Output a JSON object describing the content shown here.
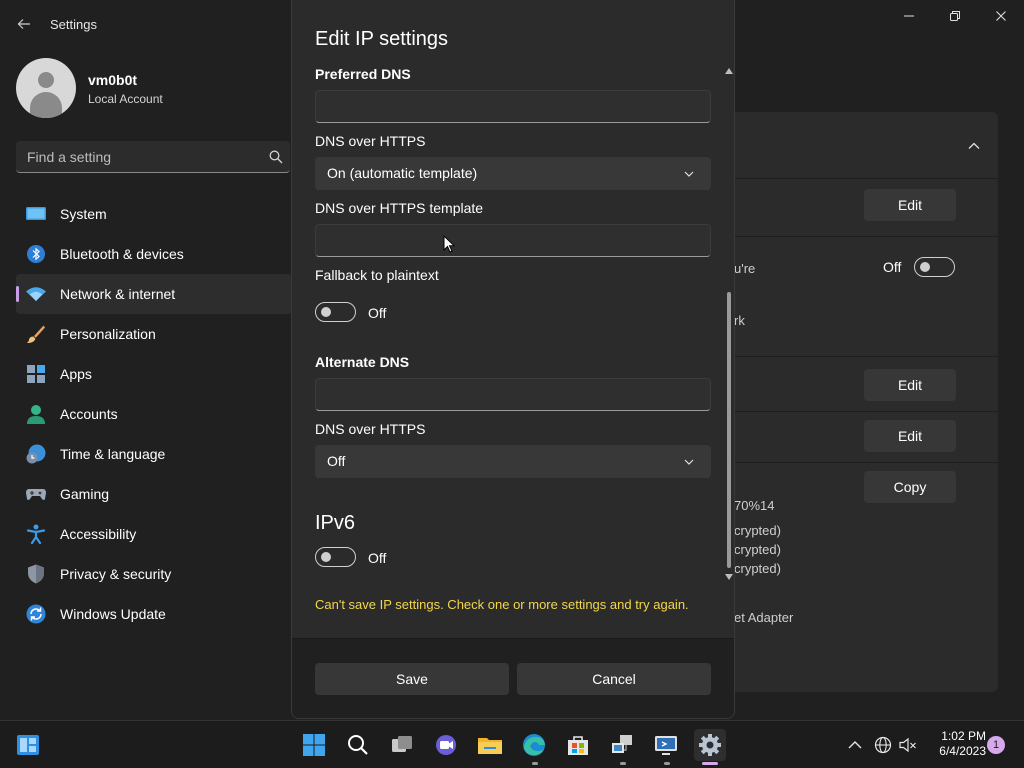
{
  "app": {
    "title": "Settings"
  },
  "profile": {
    "name": "vm0b0t",
    "account_type": "Local Account"
  },
  "search": {
    "placeholder": "Find a setting"
  },
  "sidebar": {
    "items": [
      {
        "label": "System",
        "icon": "monitor-icon"
      },
      {
        "label": "Bluetooth & devices",
        "icon": "bluetooth-icon"
      },
      {
        "label": "Network & internet",
        "icon": "wifi-icon",
        "selected": true
      },
      {
        "label": "Personalization",
        "icon": "brush-icon"
      },
      {
        "label": "Apps",
        "icon": "apps-icon"
      },
      {
        "label": "Accounts",
        "icon": "person-icon"
      },
      {
        "label": "Time & language",
        "icon": "globe-clock-icon"
      },
      {
        "label": "Gaming",
        "icon": "gamepad-icon"
      },
      {
        "label": "Accessibility",
        "icon": "accessibility-icon"
      },
      {
        "label": "Privacy & security",
        "icon": "shield-icon"
      },
      {
        "label": "Windows Update",
        "icon": "update-icon"
      }
    ]
  },
  "background_panel": {
    "edit_label": "Edit",
    "copy_label": "Copy",
    "toggle_state": "Off",
    "fragments": [
      "u're",
      "rk",
      "70%14",
      "crypted)",
      "crypted)",
      "crypted)",
      "et Adapter"
    ]
  },
  "dialog": {
    "title": "Edit IP settings",
    "preferred_dns_label": "Preferred DNS",
    "preferred_dns_value": "",
    "doh1_label": "DNS over HTTPS",
    "doh1_value": "On (automatic template)",
    "doh_template_label": "DNS over HTTPS template",
    "doh_template_value": "",
    "fallback_label": "Fallback to plaintext",
    "fallback_state": "Off",
    "alternate_dns_label": "Alternate DNS",
    "alternate_dns_value": "",
    "doh2_label": "DNS over HTTPS",
    "doh2_value": "Off",
    "ipv6_heading": "IPv6",
    "ipv6_state": "Off",
    "error_message": "Can't save IP settings. Check one or more settings and try again.",
    "save_label": "Save",
    "cancel_label": "Cancel"
  },
  "taskbar": {
    "time": "1:02 PM",
    "date": "6/4/2023",
    "notification_count": "1"
  },
  "colors": {
    "accent": "#c89ee6",
    "error": "#f2d64b",
    "background": "#202020",
    "panel": "#2b2b2b"
  }
}
